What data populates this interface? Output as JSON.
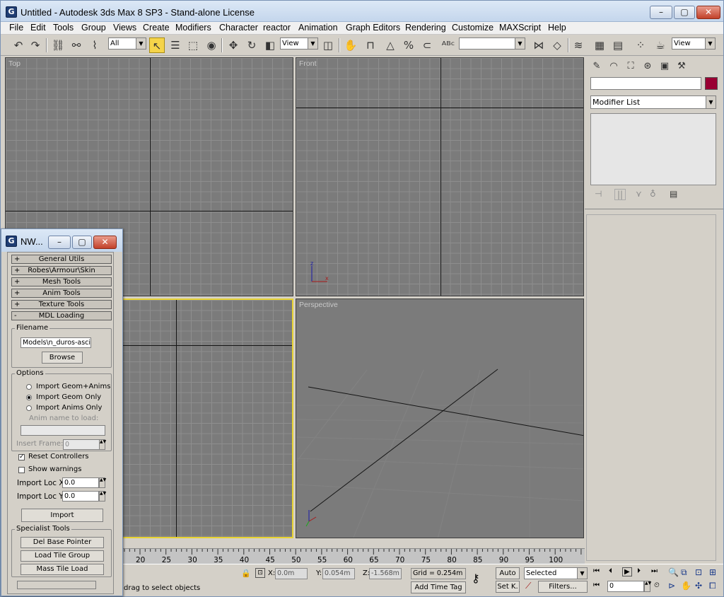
{
  "window": {
    "title": "Untitled - Autodesk 3ds Max 8 SP3  - Stand-alone License",
    "logo": "G"
  },
  "menu": [
    "File",
    "Edit",
    "Tools",
    "Group",
    "Views",
    "Create",
    "Modifiers",
    "Character",
    "reactor",
    "Animation",
    "Graph Editors",
    "Rendering",
    "Customize",
    "MAXScript",
    "Help"
  ],
  "toolbar": {
    "filter_value": "All",
    "refcoord_value": "View",
    "named_sel_value": "",
    "right_combo_value": "View"
  },
  "viewports": {
    "top": "Top",
    "front": "Front",
    "left": "",
    "perspective": "Perspective"
  },
  "command_panel": {
    "name_value": "",
    "object_color": "#990033",
    "modifier_list": "Modifier List"
  },
  "timeline": {
    "ticks": [
      "20",
      "25",
      "30",
      "35",
      "40",
      "45",
      "50",
      "55",
      "60",
      "65",
      "70",
      "75",
      "80",
      "85",
      "90",
      "95",
      "100"
    ]
  },
  "status": {
    "x_label": "X:",
    "x_value": "0.0m",
    "y_label": "Y:",
    "y_value": "0.054m",
    "z_label": "Z:",
    "z_value": "-1.568m",
    "grid": "Grid = 0.254m",
    "prompt": "drag to select objects",
    "add_time_tag": "Add Time Tag",
    "auto_key": "Auto",
    "set_key": "Set K.",
    "key_mode": "Selected",
    "filters": "Filters...",
    "frame_value": "0"
  },
  "floater": {
    "title": "NW...",
    "rollouts": [
      {
        "sign": "+",
        "label": "General Utils"
      },
      {
        "sign": "+",
        "label": "Robes\\Armour\\Skin"
      },
      {
        "sign": "+",
        "label": "Mesh Tools"
      },
      {
        "sign": "+",
        "label": "Anim Tools"
      },
      {
        "sign": "+",
        "label": "Texture Tools"
      },
      {
        "sign": "-",
        "label": "MDL Loading"
      }
    ],
    "filename_group": "Filename",
    "filename_value": "Models\\n_duros-ascii.mdl",
    "browse": "Browse",
    "options_group": "Options",
    "radio1": "Import Geom+Anims",
    "radio2": "Import Geom Only",
    "radio3": "Import Anims Only",
    "anim_name_label": "Anim name to load:",
    "anim_name_value": "",
    "insert_frame_label": "Insert Frame:",
    "insert_frame_value": "0",
    "reset_controllers": "Reset Controllers",
    "show_warnings": "Show warnings",
    "locx_label": "Import Loc X:",
    "locx_value": "0.0",
    "locy_label": "Import Loc Y:",
    "locy_value": "0.0",
    "import": "Import",
    "specialist_group": "Specialist Tools",
    "del_base": "Del Base Pointer",
    "load_tile": "Load Tile Group",
    "mass_tile": "Mass Tile Load"
  }
}
